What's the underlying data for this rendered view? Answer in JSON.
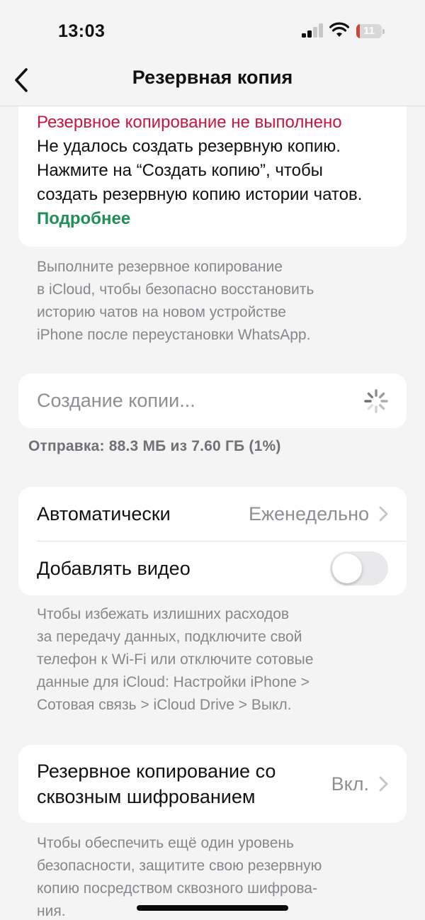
{
  "status_bar": {
    "time": "13:03",
    "battery_level": "11",
    "battery_fraction": 0.11,
    "signal_bars_active": 2,
    "signal_bars_total": 4
  },
  "nav": {
    "back_icon": "chevron-left-icon",
    "title": "Резервная копия"
  },
  "error_card": {
    "title": "Резервное копирование не выполнено",
    "body": "Не удалось создать резервную копию. Нажмите на “Создать копию”, чтобы создать резервную копию истории чатов.",
    "learn_more": "Подробнее"
  },
  "icloud_note": {
    "line1": "Выполните резервное копирование",
    "line2": "в iCloud, чтобы безопасно восстановить",
    "line3": "историю чатов на новом устройстве",
    "line4": "iPhone после переустановки WhatsApp."
  },
  "backup_progress": {
    "label": "Создание копии...",
    "status": "Отправка: 88.3 МБ из 7.60 ГБ (1%)",
    "percent": 1
  },
  "settings": {
    "auto_label": "Автоматически",
    "auto_value": "Еженедельно",
    "video_label": "Добавлять видео",
    "video_enabled": false
  },
  "data_note": {
    "line1": "Чтобы избежать излишних расходов",
    "line2": "за передачу данных, подключите свой",
    "line3": "телефон к Wi-Fi или отключите сотовые",
    "line4": "данные для iCloud: Настройки iPhone >",
    "line5": "Сотовая связь > iCloud Drive > Выкл."
  },
  "e2e": {
    "label_line1": "Резервное копирование со",
    "label_line2": "сквозным шифрованием",
    "value": "Вкл."
  },
  "security_note": {
    "line1": "Чтобы обеспечить ещё один уровень",
    "line2": "безопасности, защитите свою резервную",
    "line3": "копию посредством сквозного шифрова-",
    "line4": "ния."
  },
  "colors": {
    "error": "#c8163f",
    "link": "#1f8f56",
    "secondary_text": "#86868b",
    "background": "#f5f4f5"
  }
}
